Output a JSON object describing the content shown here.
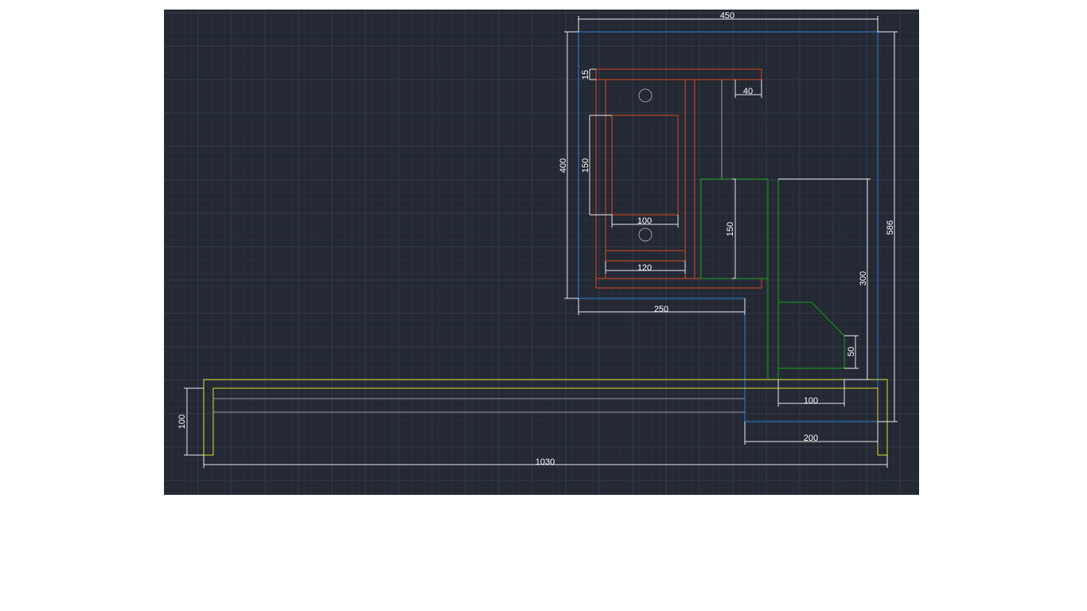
{
  "colors": {
    "background": "#232833",
    "grid_minor": "#2a303c",
    "grid_major": "#343b48",
    "blue": "#2e7fd6",
    "red": "#d8481e",
    "green": "#18a018",
    "yellow": "#dcdc2a",
    "white": "#e8e8e8",
    "gray": "#9a9a9a"
  },
  "dimensions": {
    "d450": "450",
    "d586": "586",
    "d400": "400",
    "d15": "15",
    "d40": "40",
    "d150_left": "150",
    "d100_inner": "100",
    "d120": "120",
    "d150_green": "150",
    "d300": "300",
    "d250": "250",
    "d50": "50",
    "d100_green": "100",
    "d100_left": "100",
    "d200": "200",
    "d1030": "1030"
  }
}
